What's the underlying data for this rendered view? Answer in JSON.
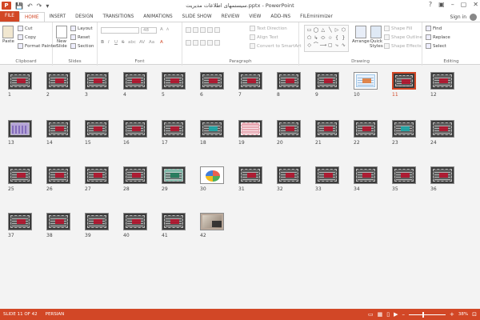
{
  "window": {
    "title": "سیستمهای اطلاعات مدیریت.pptx - PowerPoint",
    "logo": "P",
    "sign_in": "Sign in",
    "minimize": "–",
    "restore": "▢",
    "close": "✕",
    "help": "?",
    "ribbon_opts": "▣"
  },
  "qat": {
    "save": "💾",
    "undo": "↶",
    "redo": "↷",
    "customize": "▾"
  },
  "tabs": [
    {
      "label": "FILE"
    },
    {
      "label": "HOME"
    },
    {
      "label": "INSERT"
    },
    {
      "label": "DESIGN"
    },
    {
      "label": "TRANSITIONS"
    },
    {
      "label": "ANIMATIONS"
    },
    {
      "label": "SLIDE SHOW"
    },
    {
      "label": "REVIEW"
    },
    {
      "label": "VIEW"
    },
    {
      "label": "ADD-INS"
    },
    {
      "label": "FILEminimizer"
    }
  ],
  "ribbon": {
    "clipboard": {
      "label": "Clipboard",
      "paste": "Paste",
      "cut": "Cut",
      "copy": "Copy",
      "format_painter": "Format Painter"
    },
    "slides": {
      "label": "Slides",
      "new_slide": "New",
      "new_slide2": "Slide",
      "layout": "Layout",
      "reset": "Reset",
      "section": "Section"
    },
    "font": {
      "label": "Font",
      "size": "48",
      "grow": "A",
      "shrink": "A",
      "bold": "B",
      "italic": "I",
      "underline": "U",
      "strike": "S",
      "shadow": "abc",
      "spacing": "AV",
      "case": "Aa",
      "color": "A"
    },
    "paragraph": {
      "label": "Paragraph",
      "text_direction": "Text Direction",
      "align_text": "Align Text",
      "smartart": "Convert to SmartArt"
    },
    "drawing": {
      "label": "Drawing",
      "arrange": "Arrange",
      "quick_styles": "Quick",
      "quick_styles2": "Styles",
      "shape_fill": "Shape Fill",
      "shape_outline": "Shape Outline",
      "shape_effects": "Shape Effects",
      "shapes": [
        "▭",
        "◯",
        "△",
        "╲",
        "▷",
        "⬡",
        "⬠",
        "↳",
        "⬭",
        "☆",
        "{",
        "}",
        "◇",
        "⌒",
        "⟶",
        "▢",
        "⤷",
        "∿"
      ]
    },
    "editing": {
      "label": "Editing",
      "find": "Find",
      "replace": "Replace",
      "select": "Select"
    }
  },
  "slides": [
    {
      "num": "1",
      "style": "dark"
    },
    {
      "num": "2",
      "style": "dark"
    },
    {
      "num": "3",
      "style": "dark"
    },
    {
      "num": "4",
      "style": "dark"
    },
    {
      "num": "5",
      "style": "dark"
    },
    {
      "num": "6",
      "style": "dark"
    },
    {
      "num": "7",
      "style": "dark"
    },
    {
      "num": "8",
      "style": "dark"
    },
    {
      "num": "9",
      "style": "dark"
    },
    {
      "num": "10",
      "style": "light"
    },
    {
      "num": "11",
      "style": "dark",
      "selected": true
    },
    {
      "num": "12",
      "style": "dark"
    },
    {
      "num": "13",
      "style": "purple"
    },
    {
      "num": "14",
      "style": "dark"
    },
    {
      "num": "15",
      "style": "dark"
    },
    {
      "num": "16",
      "style": "dark"
    },
    {
      "num": "17",
      "style": "dark"
    },
    {
      "num": "18",
      "style": "teal"
    },
    {
      "num": "19",
      "style": "pink"
    },
    {
      "num": "20",
      "style": "dark"
    },
    {
      "num": "21",
      "style": "dark"
    },
    {
      "num": "22",
      "style": "dark"
    },
    {
      "num": "23",
      "style": "teal"
    },
    {
      "num": "24",
      "style": "dark"
    },
    {
      "num": "25",
      "style": "dark"
    },
    {
      "num": "26",
      "style": "dark"
    },
    {
      "num": "27",
      "style": "dark"
    },
    {
      "num": "28",
      "style": "dark"
    },
    {
      "num": "29",
      "style": "green"
    },
    {
      "num": "30",
      "style": "colorful"
    },
    {
      "num": "31",
      "style": "dark"
    },
    {
      "num": "32",
      "style": "dark"
    },
    {
      "num": "33",
      "style": "dark"
    },
    {
      "num": "34",
      "style": "dark"
    },
    {
      "num": "35",
      "style": "dark"
    },
    {
      "num": "36",
      "style": "dark"
    },
    {
      "num": "37",
      "style": "dark"
    },
    {
      "num": "38",
      "style": "dark"
    },
    {
      "num": "39",
      "style": "dark"
    },
    {
      "num": "40",
      "style": "dark"
    },
    {
      "num": "41",
      "style": "dark"
    },
    {
      "num": "42",
      "style": "photo"
    }
  ],
  "status": {
    "slide_info": "SLIDE 11 OF 42",
    "language": "PERSIAN",
    "zoom": "38%",
    "zoom_level": 0.38,
    "zoom_out": "–",
    "zoom_in": "+",
    "fit": "⊡"
  }
}
